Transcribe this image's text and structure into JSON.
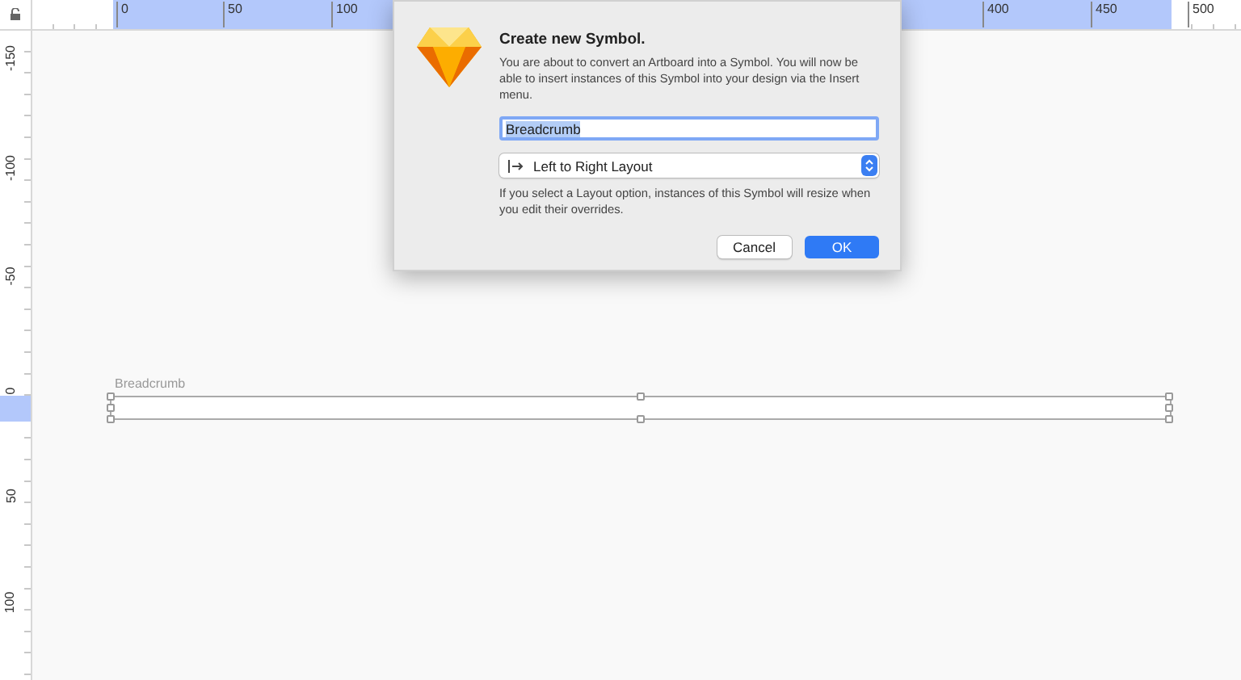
{
  "ruler_top": {
    "labels": [
      "0",
      "50",
      "100",
      "400",
      "450",
      "500"
    ]
  },
  "ruler_left": {
    "labels": [
      "-150",
      "-100",
      "-50",
      "0",
      "50",
      "100"
    ]
  },
  "artboard": {
    "name": "Breadcrumb",
    "selected": true
  },
  "dialog": {
    "title": "Create new Symbol.",
    "message": "You are about to convert an Artboard into a Symbol. You will now be able to insert instances of this Symbol into your design via the Insert menu.",
    "name_field": {
      "value": "Breadcrumb",
      "text_selected": true
    },
    "layout_select": {
      "value": "Left to Right Layout"
    },
    "note": "If you select a Layout option, instances of this Symbol will resize when you edit their overrides.",
    "buttons": [
      {
        "label": "Cancel",
        "kind": "secondary"
      },
      {
        "label": "OK",
        "kind": "primary"
      }
    ]
  }
}
